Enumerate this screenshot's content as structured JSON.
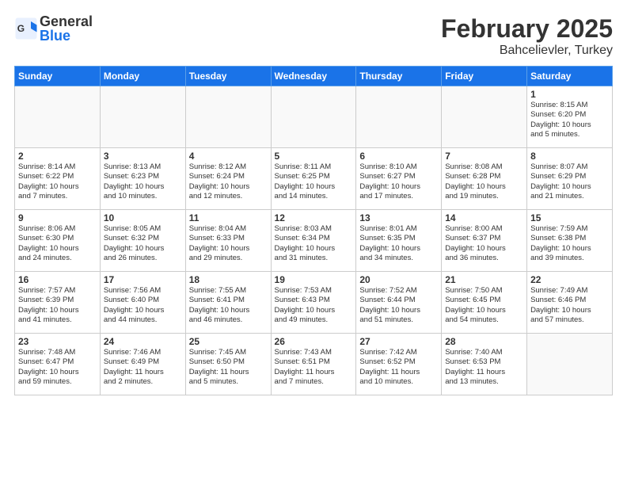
{
  "header": {
    "logo_general": "General",
    "logo_blue": "Blue",
    "title": "February 2025",
    "subtitle": "Bahcelievler, Turkey"
  },
  "days_of_week": [
    "Sunday",
    "Monday",
    "Tuesday",
    "Wednesday",
    "Thursday",
    "Friday",
    "Saturday"
  ],
  "weeks": [
    [
      {
        "day": "",
        "info": ""
      },
      {
        "day": "",
        "info": ""
      },
      {
        "day": "",
        "info": ""
      },
      {
        "day": "",
        "info": ""
      },
      {
        "day": "",
        "info": ""
      },
      {
        "day": "",
        "info": ""
      },
      {
        "day": "1",
        "info": "Sunrise: 8:15 AM\nSunset: 6:20 PM\nDaylight: 10 hours\nand 5 minutes."
      }
    ],
    [
      {
        "day": "2",
        "info": "Sunrise: 8:14 AM\nSunset: 6:22 PM\nDaylight: 10 hours\nand 7 minutes."
      },
      {
        "day": "3",
        "info": "Sunrise: 8:13 AM\nSunset: 6:23 PM\nDaylight: 10 hours\nand 10 minutes."
      },
      {
        "day": "4",
        "info": "Sunrise: 8:12 AM\nSunset: 6:24 PM\nDaylight: 10 hours\nand 12 minutes."
      },
      {
        "day": "5",
        "info": "Sunrise: 8:11 AM\nSunset: 6:25 PM\nDaylight: 10 hours\nand 14 minutes."
      },
      {
        "day": "6",
        "info": "Sunrise: 8:10 AM\nSunset: 6:27 PM\nDaylight: 10 hours\nand 17 minutes."
      },
      {
        "day": "7",
        "info": "Sunrise: 8:08 AM\nSunset: 6:28 PM\nDaylight: 10 hours\nand 19 minutes."
      },
      {
        "day": "8",
        "info": "Sunrise: 8:07 AM\nSunset: 6:29 PM\nDaylight: 10 hours\nand 21 minutes."
      }
    ],
    [
      {
        "day": "9",
        "info": "Sunrise: 8:06 AM\nSunset: 6:30 PM\nDaylight: 10 hours\nand 24 minutes."
      },
      {
        "day": "10",
        "info": "Sunrise: 8:05 AM\nSunset: 6:32 PM\nDaylight: 10 hours\nand 26 minutes."
      },
      {
        "day": "11",
        "info": "Sunrise: 8:04 AM\nSunset: 6:33 PM\nDaylight: 10 hours\nand 29 minutes."
      },
      {
        "day": "12",
        "info": "Sunrise: 8:03 AM\nSunset: 6:34 PM\nDaylight: 10 hours\nand 31 minutes."
      },
      {
        "day": "13",
        "info": "Sunrise: 8:01 AM\nSunset: 6:35 PM\nDaylight: 10 hours\nand 34 minutes."
      },
      {
        "day": "14",
        "info": "Sunrise: 8:00 AM\nSunset: 6:37 PM\nDaylight: 10 hours\nand 36 minutes."
      },
      {
        "day": "15",
        "info": "Sunrise: 7:59 AM\nSunset: 6:38 PM\nDaylight: 10 hours\nand 39 minutes."
      }
    ],
    [
      {
        "day": "16",
        "info": "Sunrise: 7:57 AM\nSunset: 6:39 PM\nDaylight: 10 hours\nand 41 minutes."
      },
      {
        "day": "17",
        "info": "Sunrise: 7:56 AM\nSunset: 6:40 PM\nDaylight: 10 hours\nand 44 minutes."
      },
      {
        "day": "18",
        "info": "Sunrise: 7:55 AM\nSunset: 6:41 PM\nDaylight: 10 hours\nand 46 minutes."
      },
      {
        "day": "19",
        "info": "Sunrise: 7:53 AM\nSunset: 6:43 PM\nDaylight: 10 hours\nand 49 minutes."
      },
      {
        "day": "20",
        "info": "Sunrise: 7:52 AM\nSunset: 6:44 PM\nDaylight: 10 hours\nand 51 minutes."
      },
      {
        "day": "21",
        "info": "Sunrise: 7:50 AM\nSunset: 6:45 PM\nDaylight: 10 hours\nand 54 minutes."
      },
      {
        "day": "22",
        "info": "Sunrise: 7:49 AM\nSunset: 6:46 PM\nDaylight: 10 hours\nand 57 minutes."
      }
    ],
    [
      {
        "day": "23",
        "info": "Sunrise: 7:48 AM\nSunset: 6:47 PM\nDaylight: 10 hours\nand 59 minutes."
      },
      {
        "day": "24",
        "info": "Sunrise: 7:46 AM\nSunset: 6:49 PM\nDaylight: 11 hours\nand 2 minutes."
      },
      {
        "day": "25",
        "info": "Sunrise: 7:45 AM\nSunset: 6:50 PM\nDaylight: 11 hours\nand 5 minutes."
      },
      {
        "day": "26",
        "info": "Sunrise: 7:43 AM\nSunset: 6:51 PM\nDaylight: 11 hours\nand 7 minutes."
      },
      {
        "day": "27",
        "info": "Sunrise: 7:42 AM\nSunset: 6:52 PM\nDaylight: 11 hours\nand 10 minutes."
      },
      {
        "day": "28",
        "info": "Sunrise: 7:40 AM\nSunset: 6:53 PM\nDaylight: 11 hours\nand 13 minutes."
      },
      {
        "day": "",
        "info": ""
      }
    ]
  ]
}
